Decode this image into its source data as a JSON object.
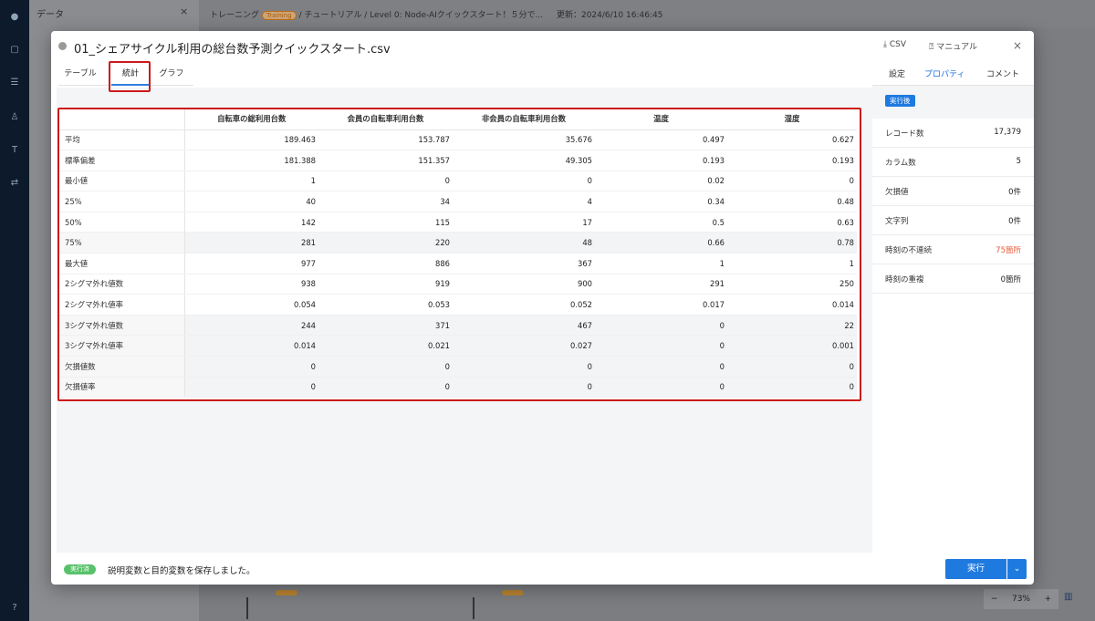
{
  "background": {
    "panel_title": "データ",
    "breadcrumb_prefix": "トレーニング",
    "breadcrumb_badge": "Training",
    "breadcrumb_rest": "/ チュートリアル / Level 0: Node-AIクイックスタート！５分で...",
    "updated": "更新：2024/6/10 16:46:45",
    "zoom_minus": "−",
    "zoom_level": "73%",
    "zoom_plus": "+",
    "close_glyph": "×"
  },
  "modal": {
    "title": "01_シェアサイクル利用の総台数予測クイックスタート.csv",
    "csv_label": "CSV",
    "manual_label": "マニュアル",
    "close_glyph": "×"
  },
  "tabs": [
    "テーブル",
    "統計",
    "グラフ"
  ],
  "stats_table": {
    "columns": [
      "",
      "自転車の総利用台数",
      "会員の自転車利用台数",
      "非会員の自転車利用台数",
      "温度",
      "湿度"
    ],
    "rows": [
      {
        "label": "平均",
        "values": [
          "189.463",
          "153.787",
          "35.676",
          "0.497",
          "0.627"
        ]
      },
      {
        "label": "標準偏差",
        "values": [
          "181.388",
          "151.357",
          "49.305",
          "0.193",
          "0.193"
        ]
      },
      {
        "label": "最小値",
        "values": [
          "1",
          "0",
          "0",
          "0.02",
          "0"
        ]
      },
      {
        "label": "25%",
        "values": [
          "40",
          "34",
          "4",
          "0.34",
          "0.48"
        ]
      },
      {
        "label": "50%",
        "values": [
          "142",
          "115",
          "17",
          "0.5",
          "0.63"
        ]
      },
      {
        "label": "75%",
        "values": [
          "281",
          "220",
          "48",
          "0.66",
          "0.78"
        ]
      },
      {
        "label": "最大値",
        "values": [
          "977",
          "886",
          "367",
          "1",
          "1"
        ]
      },
      {
        "label": "2シグマ外れ値数",
        "values": [
          "938",
          "919",
          "900",
          "291",
          "250"
        ]
      },
      {
        "label": "2シグマ外れ値率",
        "values": [
          "0.054",
          "0.053",
          "0.052",
          "0.017",
          "0.014"
        ]
      },
      {
        "label": "3シグマ外れ値数",
        "values": [
          "244",
          "371",
          "467",
          "0",
          "22"
        ]
      },
      {
        "label": "3シグマ外れ値率",
        "values": [
          "0.014",
          "0.021",
          "0.027",
          "0",
          "0.001"
        ]
      },
      {
        "label": "欠損値数",
        "values": [
          "0",
          "0",
          "0",
          "0",
          "0"
        ]
      },
      {
        "label": "欠損値率",
        "values": [
          "0",
          "0",
          "0",
          "0",
          "0"
        ]
      }
    ]
  },
  "side": {
    "tabs": [
      "設定",
      "プロパティ",
      "コメント"
    ],
    "badge": "実行後",
    "stats": [
      {
        "label": "レコード数",
        "value": "17,379"
      },
      {
        "label": "カラム数",
        "value": "5"
      },
      {
        "label": "欠損値",
        "value": "0件"
      },
      {
        "label": "文字列",
        "value": "0件"
      },
      {
        "label": "時刻の不連続",
        "value": "75箇所"
      },
      {
        "label": "時刻の重複",
        "value": "0箇所"
      }
    ]
  },
  "footer": {
    "badge": "実行済",
    "message": "説明変数と目的変数を保存しました。",
    "run_label": "実行",
    "dropdown_glyph": "⌄"
  },
  "colors": {
    "accent": "#1f7ae0",
    "highlight_box": "#cc1a1a",
    "warning": "#ea5a3c",
    "success": "#58c26a"
  }
}
